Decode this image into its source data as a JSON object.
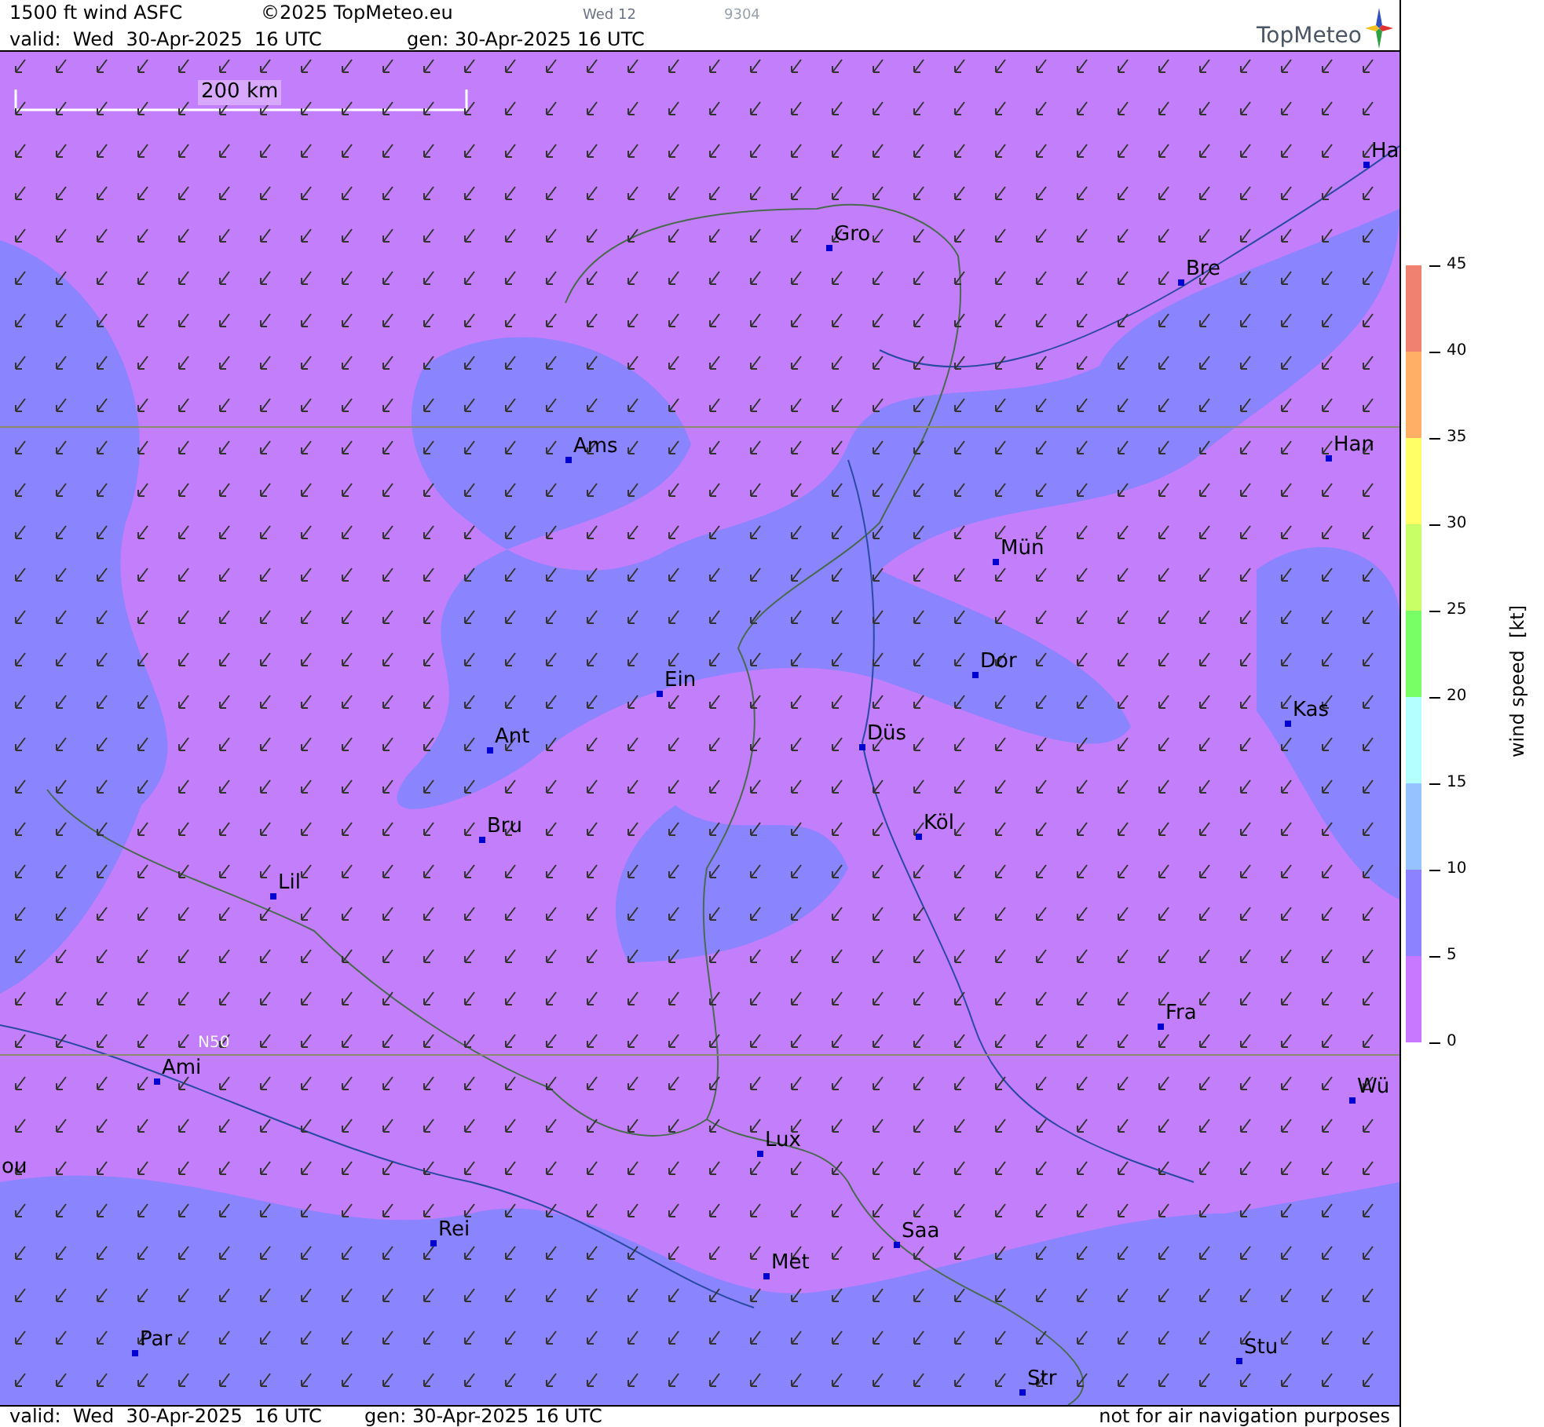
{
  "header": {
    "title": "1500 ft wind ASFC",
    "copyright": "©2025 TopMeteo.eu",
    "step": "Wed 12",
    "code": "9304",
    "valid": "valid:  Wed  30-Apr-2025  16 UTC",
    "gen": "gen: 30-Apr-2025 16 UTC",
    "logo": "TopMeteo"
  },
  "map": {
    "scale": "200 km",
    "latitude_label": "N50",
    "cities": [
      {
        "name": "Ha"
      },
      {
        "name": "Gro"
      },
      {
        "name": "Bre"
      },
      {
        "name": "Ams"
      },
      {
        "name": "Han"
      },
      {
        "name": "Mün"
      },
      {
        "name": "Dor"
      },
      {
        "name": "Ein"
      },
      {
        "name": "Kas"
      },
      {
        "name": "Düs"
      },
      {
        "name": "Ant"
      },
      {
        "name": "Köl"
      },
      {
        "name": "Bru"
      },
      {
        "name": "Lil"
      },
      {
        "name": "Fra"
      },
      {
        "name": "Ami"
      },
      {
        "name": "Wü"
      },
      {
        "name": "Lux"
      },
      {
        "name": "ou"
      },
      {
        "name": "Rei"
      },
      {
        "name": "Saa"
      },
      {
        "name": "Met"
      },
      {
        "name": "Par"
      },
      {
        "name": "Stu"
      },
      {
        "name": "Str"
      }
    ]
  },
  "legend": {
    "title": "wind speed  [kt]",
    "ticks": [
      "45",
      "40",
      "35",
      "30",
      "25",
      "20",
      "15",
      "10",
      "5",
      "0"
    ],
    "bands": [
      {
        "color": "#f08070"
      },
      {
        "color": "#ffb066"
      },
      {
        "color": "#ffff66"
      },
      {
        "color": "#c8ff66"
      },
      {
        "color": "#78ff66"
      },
      {
        "color": "#b4ffff"
      },
      {
        "color": "#96c3ff"
      },
      {
        "color": "#8c82ff"
      },
      {
        "color": "#c878ff"
      }
    ]
  },
  "footer": {
    "valid": "valid:  Wed  30-Apr-2025  16 UTC",
    "gen": "gen: 30-Apr-2025 16 UTC",
    "note": "not for air navigation purposes"
  }
}
